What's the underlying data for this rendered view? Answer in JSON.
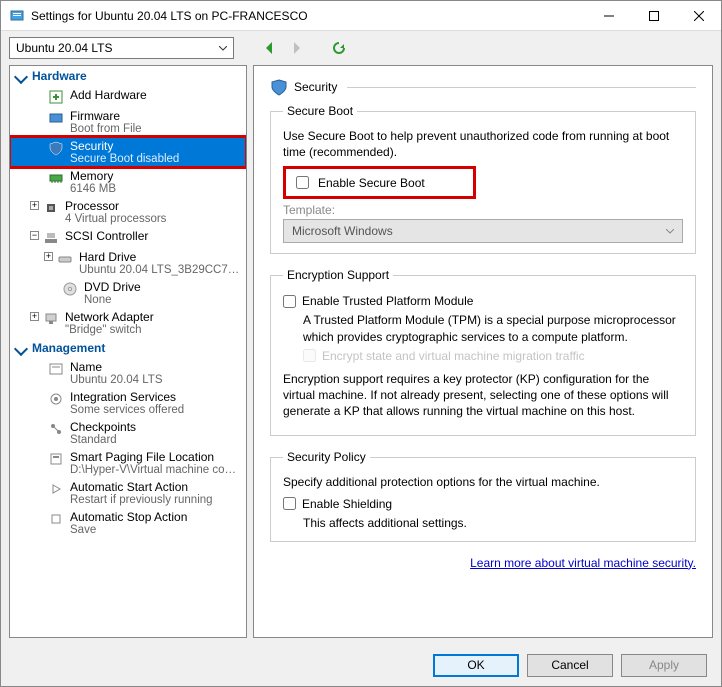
{
  "window": {
    "title": "Settings for Ubuntu 20.04 LTS on PC-FRANCESCO"
  },
  "toolbar": {
    "vm_selected": "Ubuntu 20.04 LTS"
  },
  "sidebar": {
    "hardware_label": "Hardware",
    "management_label": "Management",
    "add_hardware": "Add Hardware",
    "firmware": {
      "label": "Firmware",
      "sub": "Boot from File"
    },
    "security": {
      "label": "Security",
      "sub": "Secure Boot disabled"
    },
    "memory": {
      "label": "Memory",
      "sub": "6146 MB"
    },
    "processor": {
      "label": "Processor",
      "sub": "4 Virtual processors"
    },
    "scsi": {
      "label": "SCSI Controller"
    },
    "hard_drive": {
      "label": "Hard Drive",
      "sub": "Ubuntu 20.04 LTS_3B29CC71-..."
    },
    "dvd": {
      "label": "DVD Drive",
      "sub": "None"
    },
    "network": {
      "label": "Network Adapter",
      "sub": "\"Bridge\" switch"
    },
    "name": {
      "label": "Name",
      "sub": "Ubuntu 20.04 LTS"
    },
    "integration": {
      "label": "Integration Services",
      "sub": "Some services offered"
    },
    "checkpoints": {
      "label": "Checkpoints",
      "sub": "Standard"
    },
    "paging": {
      "label": "Smart Paging File Location",
      "sub": "D:\\Hyper-V\\Virtual machine config..."
    },
    "autostart": {
      "label": "Automatic Start Action",
      "sub": "Restart if previously running"
    },
    "autostop": {
      "label": "Automatic Stop Action",
      "sub": "Save"
    }
  },
  "panel": {
    "title": "Security",
    "secure_boot": {
      "legend": "Secure Boot",
      "desc": "Use Secure Boot to help prevent unauthorized code from running at boot time (recommended).",
      "enable_label": "Enable Secure Boot",
      "template_label": "Template:",
      "template_value": "Microsoft Windows"
    },
    "encryption": {
      "legend": "Encryption Support",
      "tpm_label": "Enable Trusted Platform Module",
      "tpm_desc": "A Trusted Platform Module (TPM) is a special purpose microprocessor which provides cryptographic services to a compute platform.",
      "encrypt_traffic_label": "Encrypt state and virtual machine migration traffic",
      "kp_desc": "Encryption support requires a key protector (KP) configuration for the virtual machine. If not already present, selecting one of these options will generate a KP that allows running the virtual machine on this host."
    },
    "policy": {
      "legend": "Security Policy",
      "desc": "Specify additional protection options for the virtual machine.",
      "shield_label": "Enable Shielding",
      "shield_desc": "This affects additional settings."
    },
    "link": "Learn more about virtual machine security."
  },
  "buttons": {
    "ok": "OK",
    "cancel": "Cancel",
    "apply": "Apply"
  }
}
